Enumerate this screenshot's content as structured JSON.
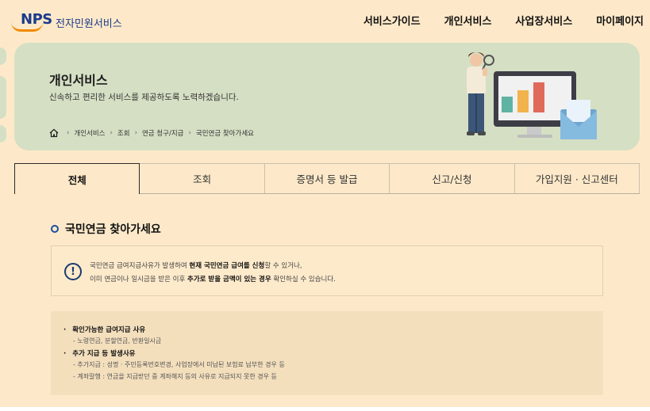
{
  "header": {
    "logo_text": "NPS",
    "logo_sub": "전자민원서비스",
    "nav": [
      "서비스가이드",
      "개인서비스",
      "사업장서비스",
      "마이페이지"
    ]
  },
  "banner": {
    "title": "개인서비스",
    "subtitle": "신속하고 편리한 서비스를 제공하도록 노력하겠습니다.",
    "breadcrumb": [
      "개인서비스",
      "조회",
      "연금 청구/지급",
      "국민연금 찾아가세요"
    ]
  },
  "tabs": [
    "전체",
    "조회",
    "증명서 등 발급",
    "신고/신청",
    "가입지원 · 신고센터"
  ],
  "section": {
    "title": "국민연금 찾아가세요"
  },
  "notice": {
    "line1_a": "국민연금 급여지급사유가 발생하여 ",
    "line1_b": "현재 국민연금 급여를 신청",
    "line1_c": "할 수 있거나,",
    "line2_a": "이미 연금이나 일시금을 받은 이후 ",
    "line2_b": "추가로 받을 금액이 있는 경우",
    "line2_c": " 확인하실 수 있습니다."
  },
  "info": {
    "b1": "확인가능한 급여지급 사유",
    "b1_d1": "- 노령연금, 분할연금, 반환일시금",
    "b2": "추가 지급 등 발생사유",
    "b2_d1": "- 추가지급 : 성명 · 주민등록번호변경, 사업장에서 미납된 보험료 납부한 경우 등",
    "b2_d2": "- 계좌말행 : 연금을 지급받던 중 계좌해지 등의 사유로 지급되지 못한 경우 등"
  },
  "colors": {
    "page_bg": "#fde9c9",
    "banner_bg": "#d5dfc4",
    "brand_blue": "#1b3a8c",
    "brand_orange": "#f08a00"
  }
}
